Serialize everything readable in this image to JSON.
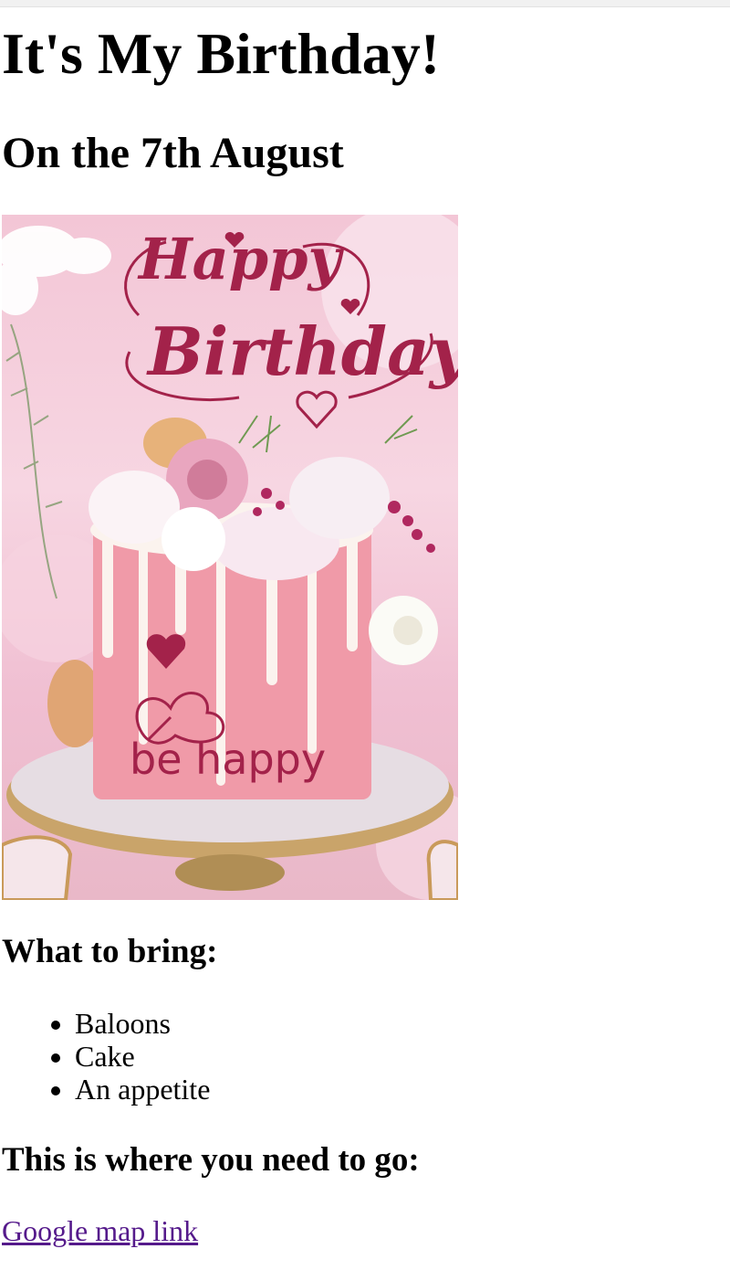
{
  "page": {
    "title": "It's My Birthday!",
    "subtitle": "On the 7th August"
  },
  "card": {
    "script_line1": "Happy",
    "script_line2": "Birthday",
    "tagline": "be happy",
    "colors": {
      "script": "#a3224a",
      "cake": "#f09aa8",
      "drip": "#fbf3ee",
      "background": "#f3c6d6"
    },
    "icons": [
      "heart-icon",
      "butterfly-icon",
      "cake-illustration",
      "flowers"
    ]
  },
  "bring": {
    "heading": "What to bring:",
    "items": [
      "Baloons",
      "Cake",
      "An appetite"
    ]
  },
  "location": {
    "heading": "This is where you need to go:",
    "link_text": "Google map link"
  }
}
